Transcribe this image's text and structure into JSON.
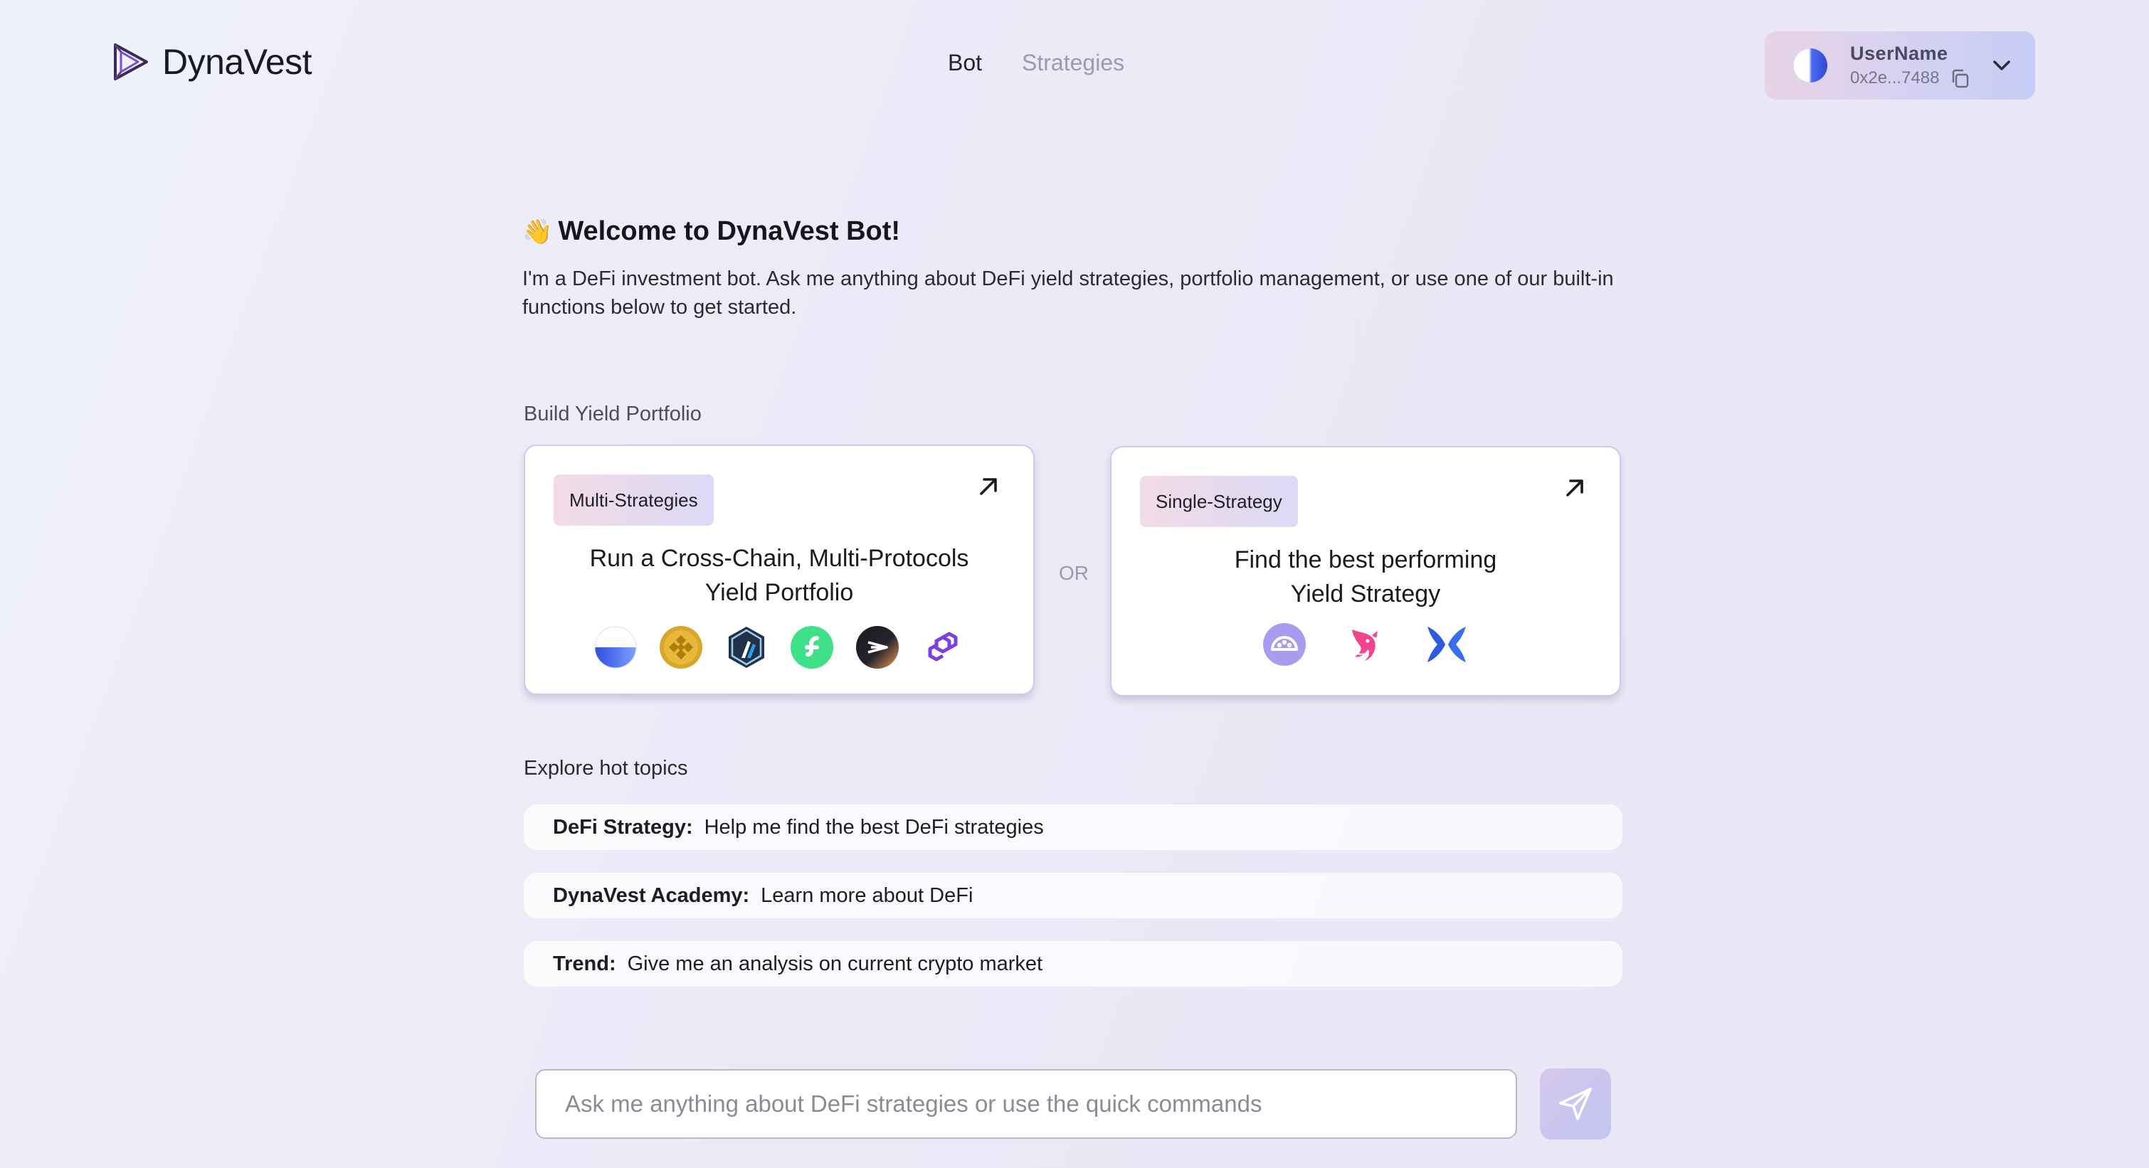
{
  "header": {
    "logo_text": "DynaVest",
    "nav": [
      {
        "label": "Bot",
        "active": true
      },
      {
        "label": "Strategies",
        "active": false
      }
    ],
    "user": {
      "name": "UserName",
      "address": "0x2e...7488"
    }
  },
  "welcome": {
    "emoji": "👋",
    "title": "Welcome to DynaVest Bot!",
    "description": "I'm a DeFi investment bot. Ask me anything about DeFi yield strategies, portfolio management, or use one of our built-in functions below to get started."
  },
  "portfolio": {
    "section_label": "Build Yield Portfolio",
    "or_label": "OR",
    "cards": [
      {
        "badge": "Multi-Strategies",
        "title_line1": "Run a Cross-Chain, Multi-Protocols",
        "title_line2": "Yield Portfolio",
        "icons": [
          "base-icon",
          "bnb-icon",
          "arbitrum-icon",
          "flow-icon",
          "celo-icon",
          "polygon-icon"
        ]
      },
      {
        "badge": "Single-Strategy",
        "title_line1": "Find the best performing",
        "title_line2": "Yield Strategy",
        "icons": [
          "camelot-icon",
          "uniswap-icon",
          "butterfly-icon"
        ]
      }
    ]
  },
  "topics": {
    "section_label": "Explore hot topics",
    "items": [
      {
        "key": "DeFi Strategy:",
        "text": "Help me find the best DeFi strategies"
      },
      {
        "key": "DynaVest Academy:",
        "text": "Learn more about DeFi"
      },
      {
        "key": "Trend:",
        "text": "Give me an analysis on current crypto market"
      }
    ]
  },
  "chat": {
    "placeholder": "Ask me anything about DeFi strategies or use the quick commands"
  },
  "colors": {
    "accent": "#4c6df2",
    "card_border": "#c8ccf0",
    "send_button": "#c8c6ef"
  }
}
